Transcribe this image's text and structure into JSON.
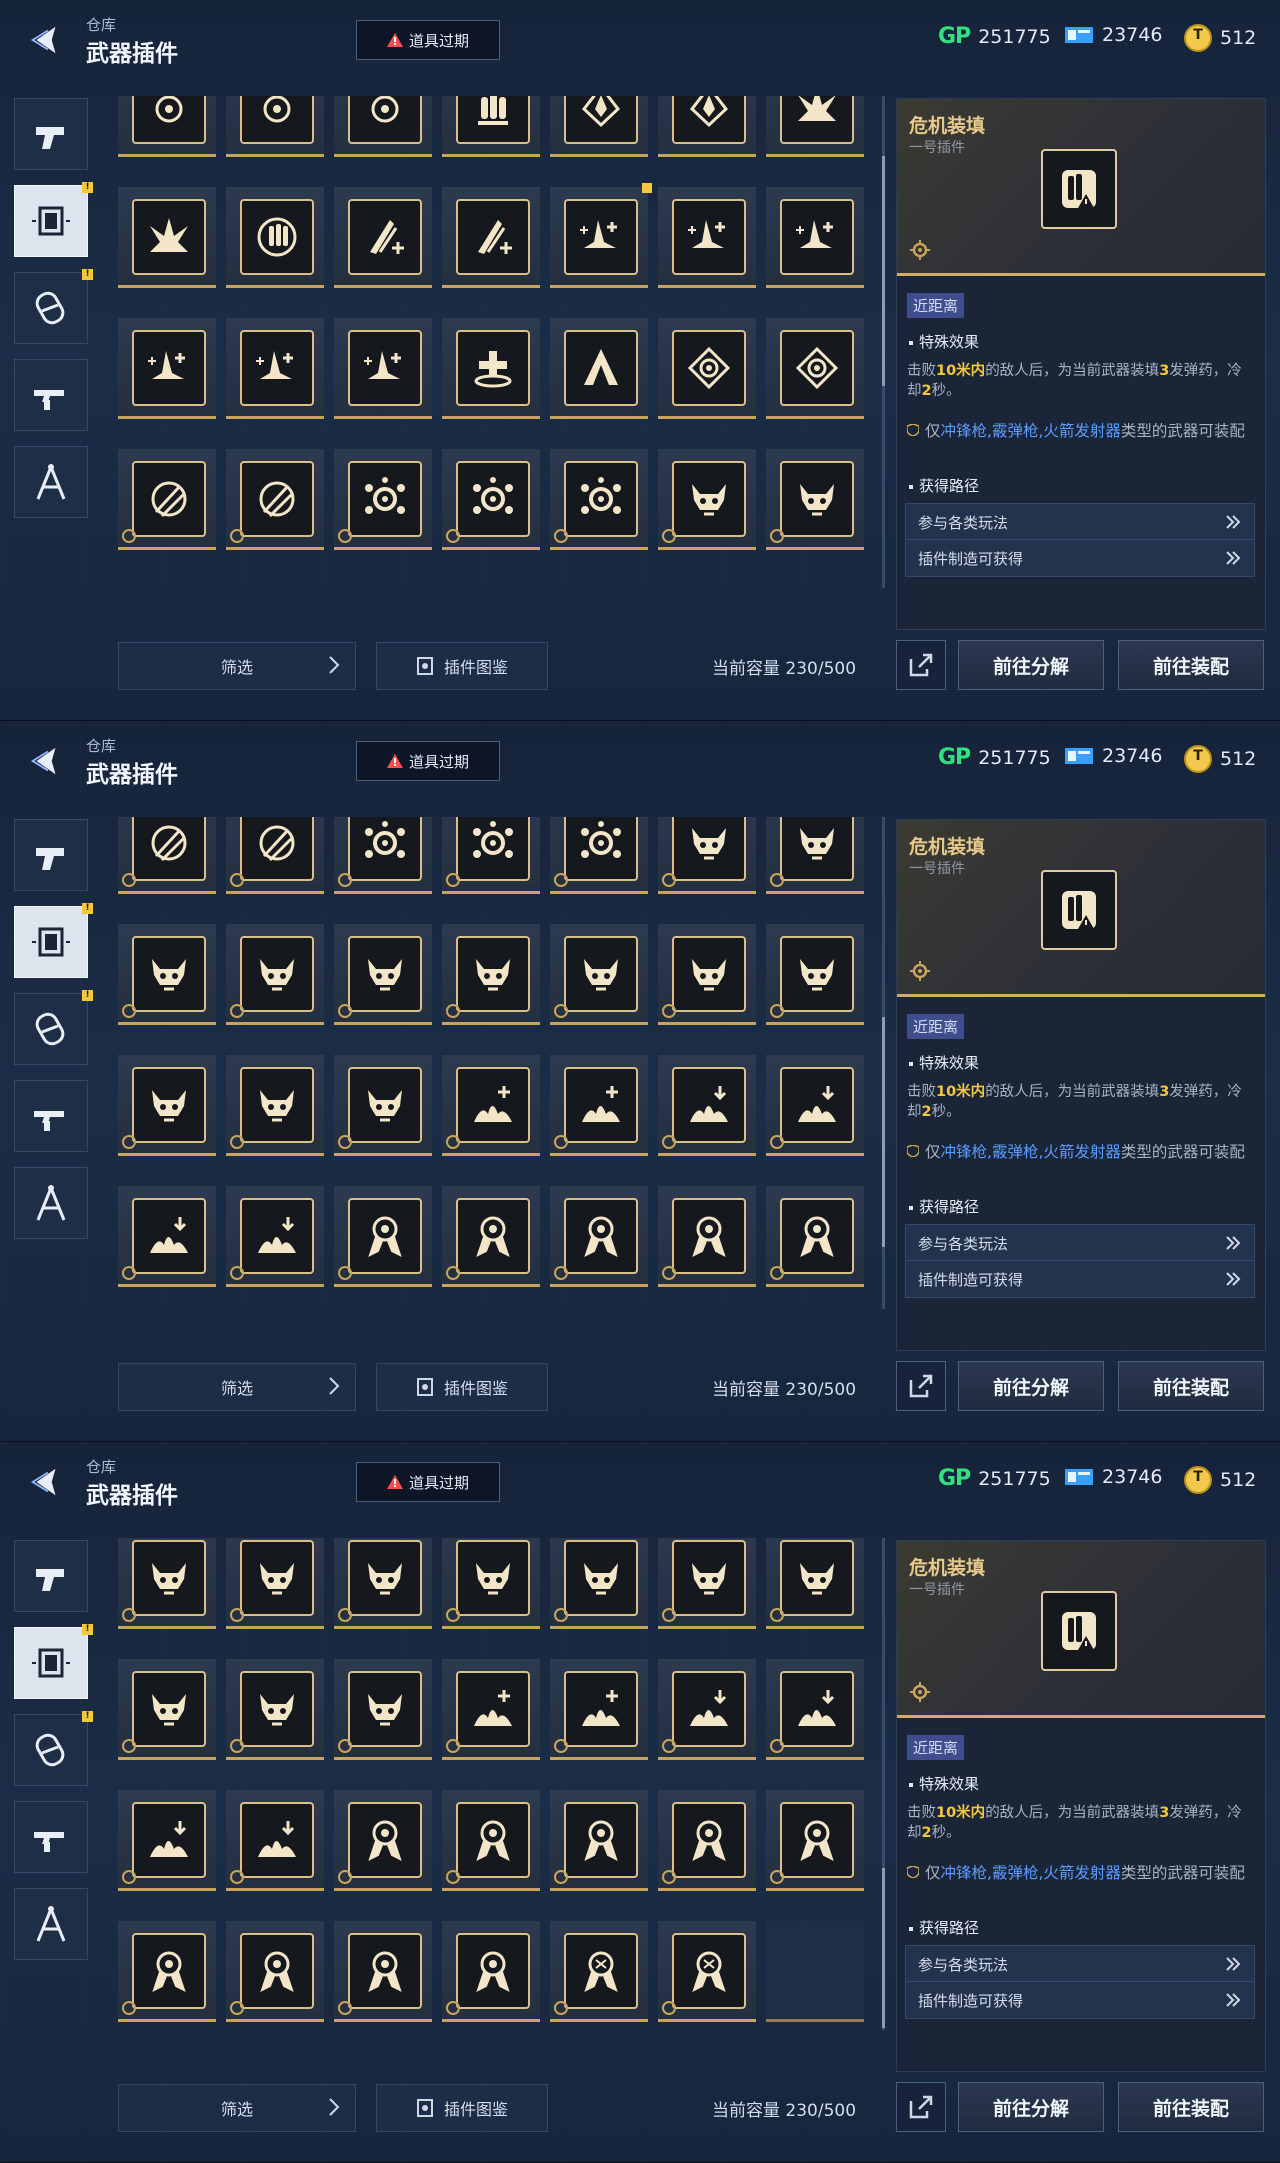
{
  "header": {
    "breadcrumb": "仓库",
    "title": "武器插件",
    "expire_label": "道具过期",
    "currencies": {
      "gp": {
        "logo": "GP",
        "value": "251775"
      },
      "ticket": {
        "value": "23746"
      },
      "coin": {
        "value": "512"
      }
    }
  },
  "side_tabs": [
    {
      "name": "pistol-icon",
      "active": false,
      "badge": false
    },
    {
      "name": "plugin-chip-icon",
      "active": true,
      "badge": true
    },
    {
      "name": "capsule-icon",
      "active": false,
      "badge": true
    },
    {
      "name": "rifle-icon",
      "active": false,
      "badge": false
    },
    {
      "name": "compass-icon",
      "active": false,
      "badge": false
    }
  ],
  "badge_mark": "!",
  "footer": {
    "filter_label": "筛选",
    "codex_label": "插件图鉴",
    "capacity_label": "当前容量",
    "capacity_value": "230/500",
    "dismantle_label": "前往分解",
    "equip_label": "前往装配"
  },
  "detail": {
    "name": "危机装填",
    "subtitle": "一号插件",
    "range_tag": "近距离",
    "effect_head": "特殊效果",
    "effect_text_parts": [
      "击败",
      "10米内",
      "的敌人后，为当前武器装填",
      "3",
      "发弹药，冷却",
      "2",
      "秒。"
    ],
    "restrict_parts": [
      "仅",
      "冲锋枪,霰弹枪,火箭发射器",
      "类型的武器可装配"
    ],
    "route_head": "获得路径",
    "routes": [
      "参与各类玩法",
      "插件制造可获得"
    ]
  },
  "screens": [
    {
      "grid_offset_label": "top",
      "rows": [
        [
          "target-crest",
          "target-crest",
          "target-crest",
          "bullets",
          "arrow-diamond",
          "arrow-diamond",
          "burst"
        ],
        [
          "burst",
          "reload-bullets",
          "slash-plus",
          "slash-plus",
          "updraft-plus",
          "updraft-plus",
          "updraft-plus"
        ],
        [
          "updraft-plus",
          "updraft-plus",
          "updraft-plus",
          "cross-pedestal",
          "spire",
          "spiral-diamond",
          "spiral-diamond"
        ],
        [
          "comet",
          "comet",
          "gear-burst",
          "gear-burst",
          "gear-burst",
          "horned-skull",
          "horned-skull"
        ]
      ]
    },
    {
      "grid_offset_label": "middle",
      "rows": [
        [
          "comet",
          "comet",
          "gear-burst",
          "gear-burst",
          "gear-burst",
          "horned-skull",
          "horned-skull"
        ],
        [
          "horned-skull",
          "horned-skull",
          "horned-skull",
          "horned-skull",
          "horned-skull",
          "horned-skull",
          "horned-skull"
        ],
        [
          "horned-skull",
          "horned-skull",
          "horned-skull",
          "splash-plus",
          "splash-plus",
          "splash-down",
          "splash-down"
        ],
        [
          "splash-down",
          "splash-down",
          "medal",
          "medal",
          "medal",
          "medal",
          "medal"
        ]
      ]
    },
    {
      "grid_offset_label": "bottom",
      "rows": [
        [
          "horned-skull",
          "horned-skull",
          "horned-skull",
          "horned-skull",
          "horned-skull",
          "horned-skull",
          "horned-skull"
        ],
        [
          "horned-skull",
          "horned-skull",
          "horned-skull",
          "splash-plus",
          "splash-plus",
          "splash-down",
          "splash-down"
        ],
        [
          "splash-down",
          "splash-down",
          "medal",
          "medal",
          "medal",
          "medal",
          "medal"
        ],
        [
          "medal",
          "medal",
          "medal",
          "medal",
          "medal-sigil",
          "medal-sigil",
          ""
        ]
      ]
    }
  ],
  "colors": {
    "accent_gold": "#c9a45c",
    "highlight_yellow": "#f1c93a",
    "highlight_blue": "#5d9bff",
    "gp_green": "#32e07f",
    "range_tag_bg": "#3f4d8e"
  }
}
